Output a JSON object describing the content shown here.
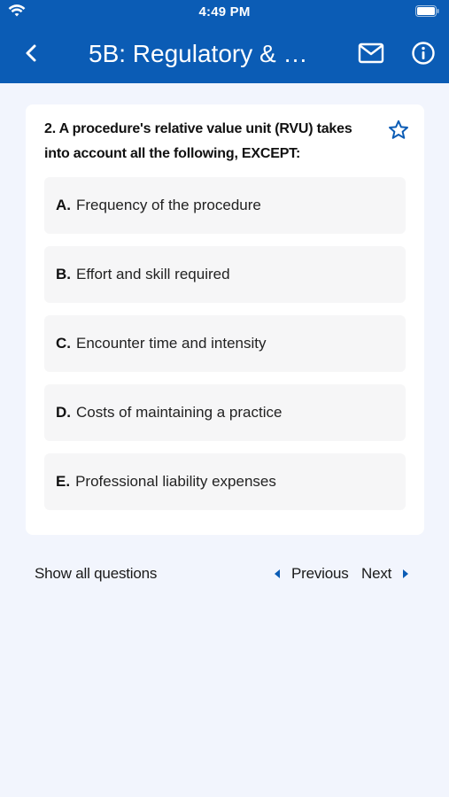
{
  "status_bar": {
    "time": "4:49 PM"
  },
  "nav": {
    "title": "5B: Regulatory & …"
  },
  "question": {
    "text": "2. A procedure's relative value unit (RVU) takes into account all the following, EXCEPT:"
  },
  "options": [
    {
      "letter": "A.",
      "text": "Frequency of the procedure"
    },
    {
      "letter": "B.",
      "text": "Effort and skill required"
    },
    {
      "letter": "C.",
      "text": "Encounter time and intensity"
    },
    {
      "letter": "D.",
      "text": "Costs of maintaining a practice"
    },
    {
      "letter": "E.",
      "text": "Professional liability expenses"
    }
  ],
  "footer": {
    "show_all": "Show all questions",
    "previous": "Previous",
    "next": "Next"
  },
  "colors": {
    "brand": "#0b5cb5",
    "background": "#f2f5fd",
    "option_bg": "#f6f6f7"
  },
  "icons": [
    "wifi-icon",
    "battery-icon",
    "back-chevron-icon",
    "mail-icon",
    "info-icon",
    "star-outline-icon",
    "triangle-left-icon",
    "triangle-right-icon"
  ]
}
